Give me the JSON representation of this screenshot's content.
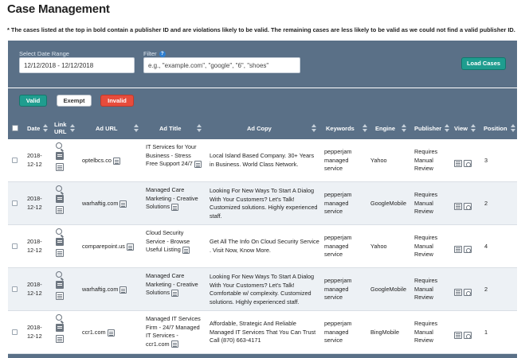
{
  "page": {
    "title": "Case Management",
    "notice": "* The cases listed at the top in bold contain a publisher ID and are violations likely to be valid. The remaining cases are less likely to be valid as we could not find a valid publisher ID."
  },
  "filters": {
    "date_label": "Select Date Range",
    "date_value": "12/12/2018 - 12/12/2018",
    "filter_label": "Filter",
    "filter_placeholder": "e.g., \"example.com\", \"google\", \"6\", \"shoes\"",
    "load_button": "Load Cases"
  },
  "status_buttons": {
    "valid": "Valid",
    "exempt": "Exempt",
    "invalid": "Invalid"
  },
  "columns": {
    "date": "Date",
    "link_url": "Link URL",
    "ad_url": "Ad URL",
    "ad_title": "Ad Title",
    "ad_copy": "Ad Copy",
    "keywords": "Keywords",
    "engine": "Engine",
    "publisher": "Publisher",
    "view": "View",
    "position": "Position"
  },
  "rows": [
    {
      "date": "2018-12-12",
      "ad_url": "optelbcs.co",
      "ad_title": "IT Services for Your Business - Stress Free Support 24/7",
      "ad_copy": "Local Island Based Company. 30+ Years in Business. World Class Network.",
      "keywords": "pepperjam managed service",
      "engine": "Yahoo",
      "publisher": "Requires Manual Review",
      "position": "3"
    },
    {
      "date": "2018-12-12",
      "ad_url": "warhaftig.com",
      "ad_title": "Managed Care Marketing - Creative Solutions",
      "ad_copy": "Looking For New Ways To Start A Dialog With Your Customers? Let's Talk! Customized solutions. Highly experienced staff.",
      "keywords": "pepperjam managed service",
      "engine": "GoogleMobile",
      "publisher": "Requires Manual Review",
      "position": "2"
    },
    {
      "date": "2018-12-12",
      "ad_url": "comparepoint.us",
      "ad_title": "Cloud Security Service - Browse Useful Listing",
      "ad_copy": "Get All The Info On Cloud Security Service . Visit Now, Know More.",
      "keywords": "pepperjam managed service",
      "engine": "Yahoo",
      "publisher": "Requires Manual Review",
      "position": "4"
    },
    {
      "date": "2018-12-12",
      "ad_url": "warhaftig.com",
      "ad_title": "Managed Care Marketing - Creative Solutions",
      "ad_copy": "Looking For New Ways To Start A Dialog With Your Customers? Let's Talk! Comfortable w/ complexity. Customized solutions. Highly experienced staff.",
      "keywords": "pepperjam managed service",
      "engine": "GoogleMobile",
      "publisher": "Requires Manual Review",
      "position": "2"
    },
    {
      "date": "2018-12-12",
      "ad_url": "ccr1.com",
      "ad_title": "Managed IT Services Firm - 24/7 Managed IT Services - ccr1.com",
      "ad_copy": "Affordable, Strategic And Reliable Managed IT Services That You Can Trust Call (870) 663-4171",
      "keywords": "pepperjam managed service",
      "engine": "BingMobile",
      "publisher": "Requires Manual Review",
      "position": "1"
    }
  ],
  "icons": {
    "link_url": [
      "magnifier-icon",
      "screenshot-icon",
      "details-icon"
    ],
    "view": [
      "grid-view-icon",
      "camera-icon"
    ],
    "inline": "document-icon"
  }
}
